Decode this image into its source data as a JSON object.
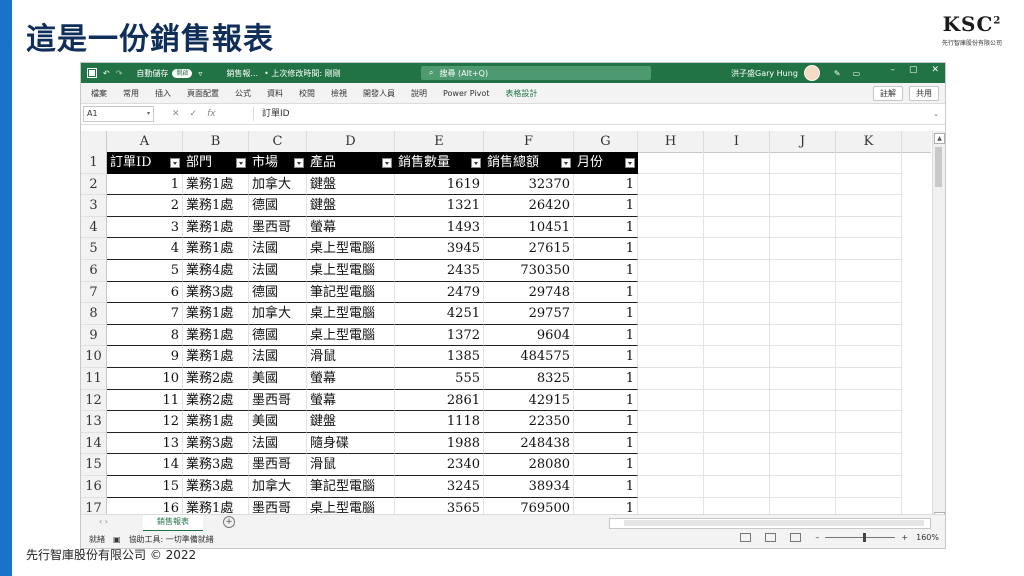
{
  "slide": {
    "title": "這是一份銷售報表",
    "footer": "先行智庫股份有限公司 © 2022",
    "logo_text": "KSC",
    "logo_sup": "2",
    "logo_sub": "先行智庫股份有限公司",
    "accent_color": "#1a73c8"
  },
  "excel": {
    "brand_color": "#217346",
    "titlebar": {
      "autosave_label": "自動儲存",
      "autosave_state": "開啟",
      "file_name": "銷售報...",
      "last_modified": "• 上次修改時間: 剛剛",
      "search_placeholder": "搜尋 (Alt+Q)",
      "user_name": "洪子盛Gary Hung"
    },
    "ribbon": {
      "tabs": [
        "檔案",
        "常用",
        "插入",
        "頁面配置",
        "公式",
        "資料",
        "校閱",
        "檢視",
        "開發人員",
        "說明",
        "Power Pivot",
        "表格設計"
      ],
      "comment_button": "註解",
      "share_button": "共用"
    },
    "formula_bar": {
      "name_box": "A1",
      "content": "訂單ID"
    },
    "columns": [
      "A",
      "B",
      "C",
      "D",
      "E",
      "F",
      "G",
      "H",
      "I",
      "J",
      "K"
    ],
    "row_numbers": [
      "1",
      "2",
      "3",
      "4",
      "5",
      "6",
      "7",
      "8",
      "9",
      "10",
      "11",
      "12",
      "13",
      "14",
      "15",
      "16",
      "17"
    ],
    "table": {
      "headers": [
        "訂單ID",
        "部門",
        "市場",
        "產品",
        "銷售數量",
        "銷售總額",
        "月份"
      ],
      "rows": [
        [
          "1",
          "業務1處",
          "加拿大",
          "鍵盤",
          "1619",
          "32370",
          "1"
        ],
        [
          "2",
          "業務1處",
          "德國",
          "鍵盤",
          "1321",
          "26420",
          "1"
        ],
        [
          "3",
          "業務1處",
          "墨西哥",
          "螢幕",
          "1493",
          "10451",
          "1"
        ],
        [
          "4",
          "業務1處",
          "法國",
          "桌上型電腦",
          "3945",
          "27615",
          "1"
        ],
        [
          "5",
          "業務4處",
          "法國",
          "桌上型電腦",
          "2435",
          "730350",
          "1"
        ],
        [
          "6",
          "業務3處",
          "德國",
          "筆記型電腦",
          "2479",
          "29748",
          "1"
        ],
        [
          "7",
          "業務1處",
          "加拿大",
          "桌上型電腦",
          "4251",
          "29757",
          "1"
        ],
        [
          "8",
          "業務1處",
          "德國",
          "桌上型電腦",
          "1372",
          "9604",
          "1"
        ],
        [
          "9",
          "業務1處",
          "法國",
          "滑鼠",
          "1385",
          "484575",
          "1"
        ],
        [
          "10",
          "業務2處",
          "美國",
          "螢幕",
          "555",
          "8325",
          "1"
        ],
        [
          "11",
          "業務2處",
          "墨西哥",
          "螢幕",
          "2861",
          "42915",
          "1"
        ],
        [
          "12",
          "業務1處",
          "美國",
          "鍵盤",
          "1118",
          "22350",
          "1"
        ],
        [
          "13",
          "業務3處",
          "法國",
          "隨身碟",
          "1988",
          "248438",
          "1"
        ],
        [
          "14",
          "業務3處",
          "墨西哥",
          "滑鼠",
          "2340",
          "28080",
          "1"
        ],
        [
          "15",
          "業務3處",
          "加拿大",
          "筆記型電腦",
          "3245",
          "38934",
          "1"
        ],
        [
          "16",
          "業務1處",
          "墨西哥",
          "桌上型電腦",
          "3565",
          "769500",
          "1"
        ]
      ]
    },
    "sheet_tab": "銷售報表",
    "status": {
      "ready": "就緒",
      "accessibility": "協助工具: 一切準備就緒",
      "zoom": "160%"
    }
  }
}
